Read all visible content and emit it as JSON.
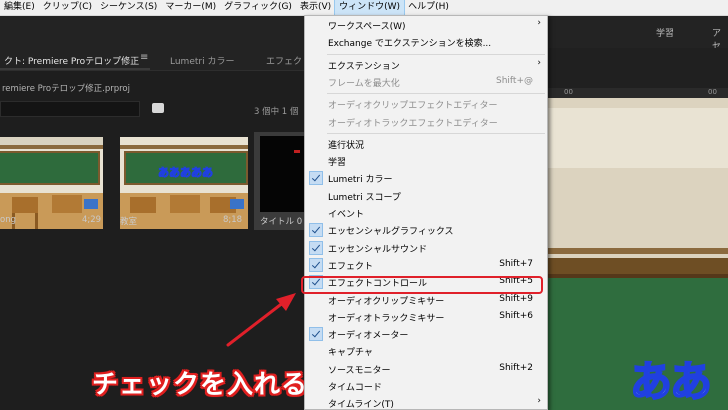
{
  "menubar": {
    "items": [
      {
        "label": "編集(E)"
      },
      {
        "label": "クリップ(C)"
      },
      {
        "label": "シーケンス(S)"
      },
      {
        "label": "マーカー(M)"
      },
      {
        "label": "グラフィック(G)"
      },
      {
        "label": "表示(V)"
      },
      {
        "label": "ウィンドウ(W)",
        "active": true
      },
      {
        "label": "ヘルプ(H)"
      }
    ]
  },
  "workspace": {
    "tabs": [
      "学習",
      "アセ"
    ]
  },
  "project_panel": {
    "tabs": [
      {
        "label": "クト: Premiere Proテロップ修正"
      },
      {
        "label": "Lumetri カラー"
      },
      {
        "label": "エフェク"
      }
    ],
    "file": "remiere Proテロップ修正.prproj",
    "count": "3 個中 1 個",
    "clips": [
      {
        "name": "ong",
        "duration": "4;29"
      },
      {
        "name": "教室",
        "duration": "8;18",
        "overlay": "あああああ"
      },
      {
        "name": "タイトル 0",
        "duration": ""
      }
    ]
  },
  "program": {
    "ruler": [
      "00",
      "00"
    ],
    "overlay": "ああ"
  },
  "dropdown": {
    "items": [
      {
        "label": "ワークスペース(W)",
        "submenu": true
      },
      {
        "label": "Exchange でエクステンションを検索..."
      },
      {
        "separator": true
      },
      {
        "label": "エクステンション",
        "submenu": true
      },
      {
        "label": "フレームを最大化",
        "shortcut": "Shift+@",
        "disabled": true
      },
      {
        "separator": true
      },
      {
        "label": "オーディオクリップエフェクトエディター",
        "disabled": true
      },
      {
        "label": "オーディオトラックエフェクトエディター",
        "disabled": true
      },
      {
        "separator": true
      },
      {
        "label": "進行状況"
      },
      {
        "label": "学習"
      },
      {
        "label": "Lumetri カラー",
        "checked": true
      },
      {
        "label": "Lumetri スコープ"
      },
      {
        "label": "イベント"
      },
      {
        "label": "エッセンシャルグラフィックス",
        "checked": true
      },
      {
        "label": "エッセンシャルサウンド",
        "checked": true
      },
      {
        "label": "エフェクト",
        "shortcut": "Shift+7",
        "checked": true
      },
      {
        "label": "エフェクトコントロール",
        "shortcut": "Shift+5",
        "checked": true
      },
      {
        "label": "オーディオクリップミキサー",
        "shortcut": "Shift+9"
      },
      {
        "label": "オーディオトラックミキサー",
        "shortcut": "Shift+6"
      },
      {
        "label": "オーディオメーター",
        "checked": true
      },
      {
        "label": "キャプチャ"
      },
      {
        "label": "ソースモニター",
        "shortcut": "Shift+2"
      },
      {
        "label": "タイムコード"
      },
      {
        "label": "タイムライン(T)",
        "submenu": true
      }
    ]
  },
  "annotation": {
    "text": "チェックを入れる",
    "color": "#e0202a"
  }
}
